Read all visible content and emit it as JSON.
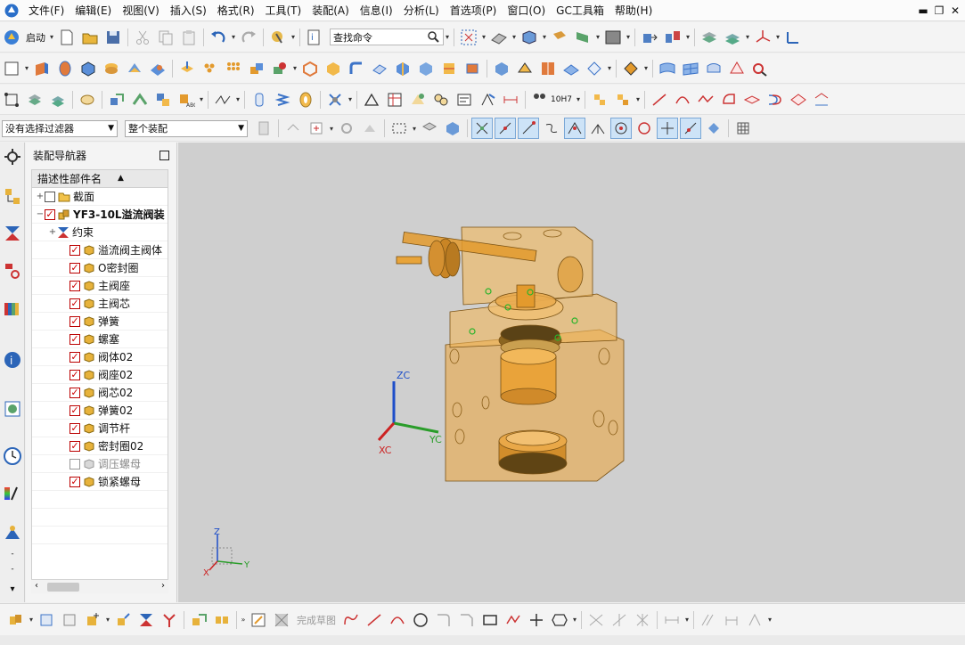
{
  "menu": {
    "items": [
      "文件(F)",
      "编辑(E)",
      "视图(V)",
      "插入(S)",
      "格式(R)",
      "工具(T)",
      "装配(A)",
      "信息(I)",
      "分析(L)",
      "首选项(P)",
      "窗口(O)",
      "GC工具箱",
      "帮助(H)"
    ]
  },
  "toolbar": {
    "start_label": "启动",
    "search_placeholder": "查找命令",
    "drawing_label": "10H7"
  },
  "filters": {
    "selection_filter": "没有选择过滤器",
    "scope": "整个装配"
  },
  "nav": {
    "title": "装配导航器",
    "column_header": "描述性部件名",
    "rows": [
      {
        "label": "截面",
        "level": 0,
        "expand": "+",
        "check": "none",
        "icon": "folder",
        "bold": false,
        "dim": false
      },
      {
        "label": "YF3-10L溢流阀装",
        "level": 0,
        "expand": "−",
        "check": "on",
        "icon": "assembly",
        "bold": true,
        "dim": false
      },
      {
        "label": "约束",
        "level": 1,
        "expand": "+",
        "check": "hidden",
        "icon": "constraint",
        "bold": false,
        "dim": false
      },
      {
        "label": "溢流阀主阀体",
        "level": 2,
        "expand": "",
        "check": "on",
        "icon": "part",
        "bold": false,
        "dim": false
      },
      {
        "label": "O密封圈",
        "level": 2,
        "expand": "",
        "check": "on",
        "icon": "part",
        "bold": false,
        "dim": false
      },
      {
        "label": "主阀座",
        "level": 2,
        "expand": "",
        "check": "on",
        "icon": "part",
        "bold": false,
        "dim": false
      },
      {
        "label": "主阀芯",
        "level": 2,
        "expand": "",
        "check": "on",
        "icon": "part",
        "bold": false,
        "dim": false
      },
      {
        "label": "弹簧",
        "level": 2,
        "expand": "",
        "check": "on",
        "icon": "part",
        "bold": false,
        "dim": false
      },
      {
        "label": "螺塞",
        "level": 2,
        "expand": "",
        "check": "on",
        "icon": "part",
        "bold": false,
        "dim": false
      },
      {
        "label": "阀体02",
        "level": 2,
        "expand": "",
        "check": "on",
        "icon": "part",
        "bold": false,
        "dim": false
      },
      {
        "label": "阀座02",
        "level": 2,
        "expand": "",
        "check": "on",
        "icon": "part",
        "bold": false,
        "dim": false
      },
      {
        "label": "阀芯02",
        "level": 2,
        "expand": "",
        "check": "on",
        "icon": "part",
        "bold": false,
        "dim": false
      },
      {
        "label": "弹簧02",
        "level": 2,
        "expand": "",
        "check": "on",
        "icon": "part",
        "bold": false,
        "dim": false
      },
      {
        "label": "调节杆",
        "level": 2,
        "expand": "",
        "check": "on",
        "icon": "part",
        "bold": false,
        "dim": false
      },
      {
        "label": "密封圈02",
        "level": 2,
        "expand": "",
        "check": "on",
        "icon": "part",
        "bold": false,
        "dim": false
      },
      {
        "label": "调压螺母",
        "level": 2,
        "expand": "",
        "check": "grey",
        "icon": "part-grey",
        "bold": false,
        "dim": true
      },
      {
        "label": "锁紧螺母",
        "level": 2,
        "expand": "",
        "check": "on",
        "icon": "part",
        "bold": false,
        "dim": false
      }
    ]
  },
  "viewport": {
    "axis_labels": {
      "zc": "ZC",
      "xc": "XC",
      "yc": "YC",
      "z": "Z",
      "x": "X",
      "y": "Y"
    }
  },
  "bottom": {
    "finish_sketch_label": "完成草图"
  },
  "colors": {
    "part_orange": "#e8a43a",
    "viewport_bg": "#cfcfcf"
  }
}
